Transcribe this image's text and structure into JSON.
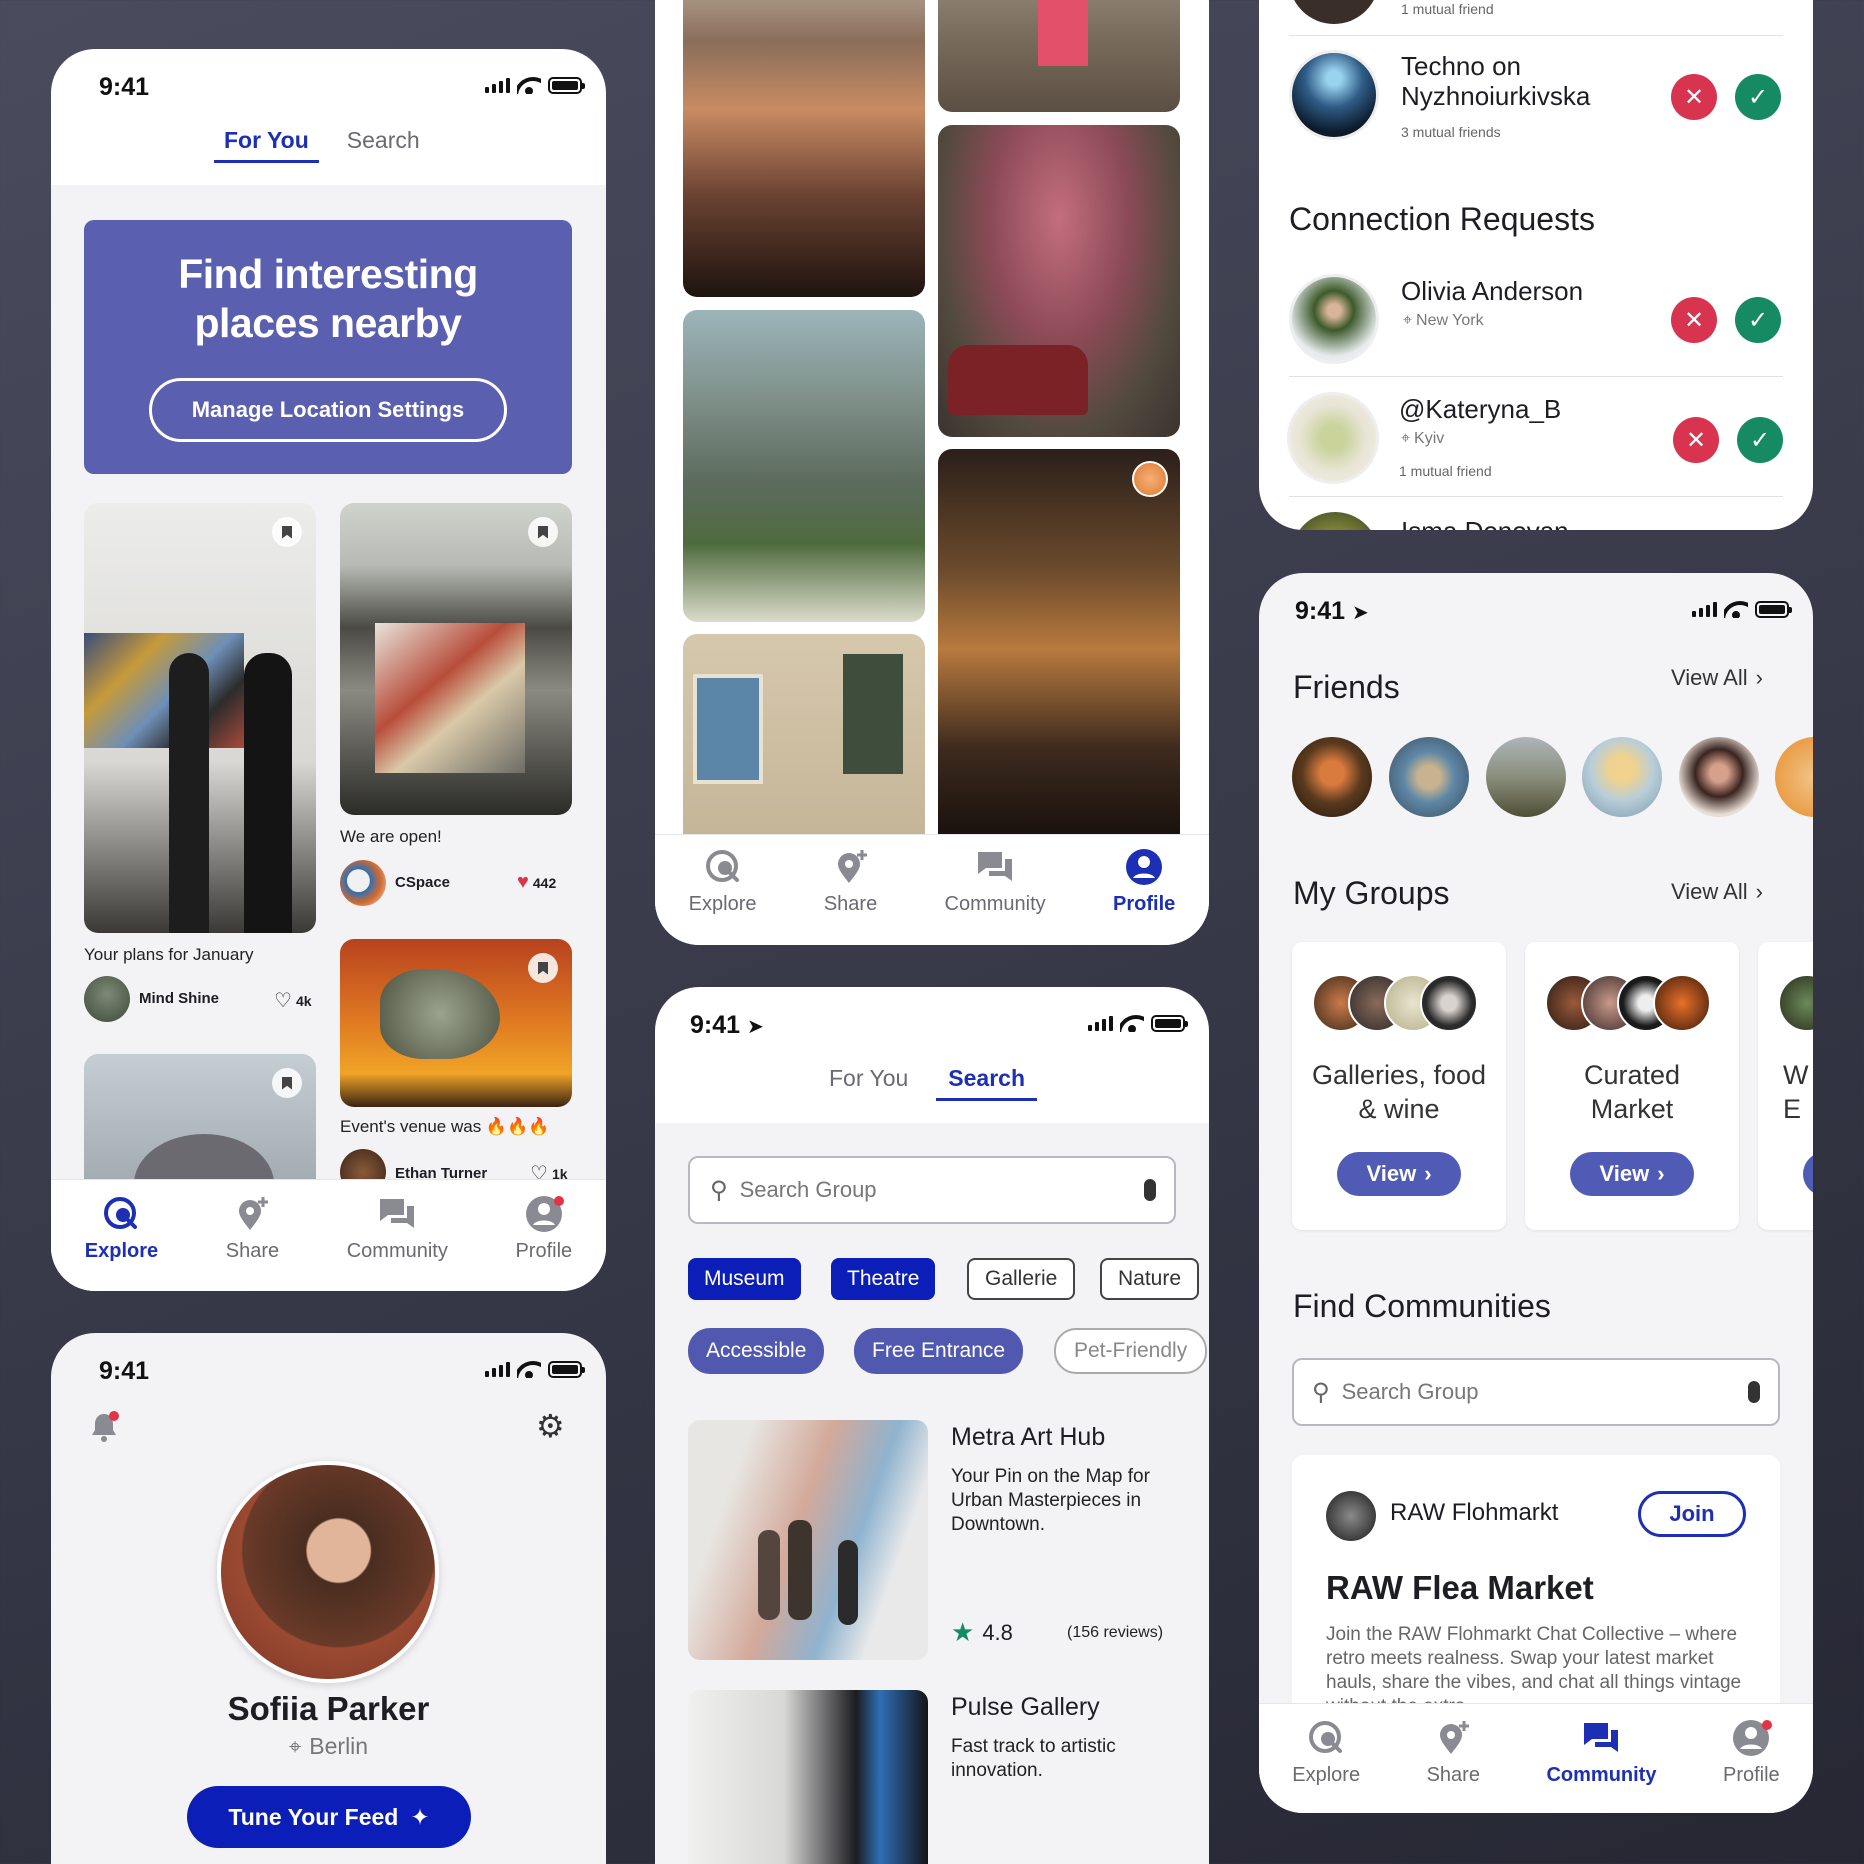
{
  "explore": {
    "time": "9:41",
    "tab_for_you": "For You",
    "tab_search": "Search",
    "banner_title": "Find interesting places nearby",
    "banner_button": "Manage Location Settings",
    "posts": [
      {
        "caption": "Your plans for January",
        "author": "Mind Shine",
        "likes": "4k"
      },
      {
        "caption": "We are open!",
        "author": "CSpace",
        "likes": "442"
      },
      {
        "caption": "Event's venue was 🔥🔥🔥",
        "author": "Ethan Turner",
        "likes": "1k"
      }
    ]
  },
  "nav": {
    "explore": "Explore",
    "share": "Share",
    "community": "Community",
    "profile": "Profile"
  },
  "profile": {
    "time": "9:41",
    "name": "Sofiia Parker",
    "location": "Berlin",
    "button": "Tune Your Feed"
  },
  "search": {
    "time": "9:41",
    "tab_for_you": "For You",
    "tab_search": "Search",
    "placeholder": "Search Group",
    "chips": [
      "Museum",
      "Theatre",
      "Gallerie",
      "Nature"
    ],
    "chips2": [
      "Accessible",
      "Free Entrance",
      "Pet-Friendly"
    ],
    "results": [
      {
        "title": "Metra Art Hub",
        "desc": "Your Pin on the Map for Urban Masterpieces in Downtown.",
        "rating": "4.8",
        "reviews": "(156 reviews)"
      },
      {
        "title": "Pulse Gallery",
        "desc": "Fast track to artistic innovation."
      }
    ]
  },
  "requests": {
    "top_mutual": "1 mutual friend",
    "suggest": {
      "name": "Techno on Nyzhnoiurkivska",
      "mutual": "3 mutual friends"
    },
    "heading": "Connection Requests",
    "items": [
      {
        "name": "Olivia Anderson",
        "location": "New York"
      },
      {
        "name": "@Kateryna_B",
        "location": "Kyiv",
        "mutual": "1 mutual friend"
      },
      {
        "name": "Isma Donovan"
      }
    ]
  },
  "community": {
    "time": "9:41",
    "friends": "Friends",
    "view_all": "View All",
    "groups": "My Groups",
    "group_cards": [
      {
        "name": "Galleries, food & wine",
        "button": "View"
      },
      {
        "name": "Curated Market",
        "button": "View"
      },
      {
        "name": "W E"
      }
    ],
    "find": "Find Communities",
    "placeholder": "Search Group",
    "feature": {
      "account": "RAW Flohmarkt",
      "join": "Join",
      "title": "RAW Flea Market",
      "desc": "Join the RAW Flohmarkt Chat Collective – where retro meets realness. Swap your latest market hauls, share the vibes, and chat all things vintage without the extra"
    }
  },
  "colors": {
    "accent": "#1d2fb4",
    "banner": "#5a5fb0",
    "chip_blue": "#0b1fb8",
    "chip_soft": "#5058b0",
    "decline": "#d8344f",
    "accept": "#168a63",
    "notify": "#e43346"
  },
  "icons": [
    "explore-icon",
    "share-pin-icon",
    "community-chat-icon",
    "profile-icon",
    "bookmark-icon",
    "heart-icon",
    "bell-icon",
    "gear-icon",
    "location-pin-icon",
    "sparkle-icon",
    "search-icon",
    "mic-icon",
    "star-icon",
    "close-icon",
    "check-icon",
    "chevron-right-icon",
    "location-arrow-icon"
  ]
}
